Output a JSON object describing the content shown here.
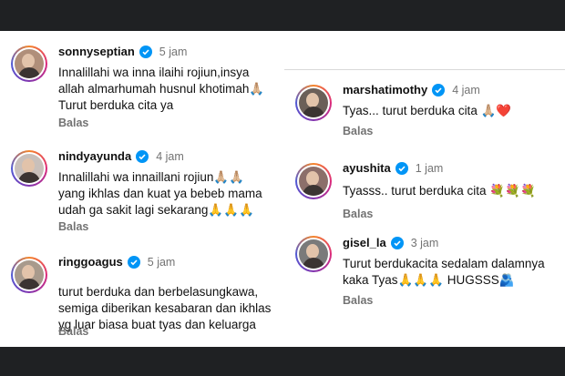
{
  "colors": {
    "verified": "#0095f6",
    "muted": "#737373",
    "background": "#1f2123"
  },
  "left_comments": [
    {
      "username": "sonnyseptian",
      "time": "5 jam",
      "lines": [
        "Innalillahi wa inna ilaihi rojiun,insya",
        "allah almarhumah husnul khotimah🙏🏼",
        "Turut berduka cita ya"
      ],
      "reply": "Balas"
    },
    {
      "username": "nindyayunda",
      "time": "4 jam",
      "lines": [
        "Innalillahi wa innaillani rojiun🙏🏼🙏🏼",
        "yang ikhlas dan kuat ya bebeb mama",
        "udah ga sakit lagi sekarang🙏🙏🙏"
      ],
      "reply": "Balas"
    },
    {
      "username": "ringgoagus",
      "time": "5 jam",
      "lines": [
        "turut berduka dan berbelasungkawa,",
        "semiga diberikan kesabaran dan ikhlas",
        "yg luar biasa buat tyas dan keluarga"
      ],
      "reply": "Balas"
    }
  ],
  "right_comments": [
    {
      "username": "marshatimothy",
      "time": "4 jam",
      "lines": [
        "Tyas... turut berduka cita 🙏🏼❤️"
      ],
      "reply": "Balas"
    },
    {
      "username": "ayushita",
      "time": "1 jam",
      "lines": [
        "Tyasss.. turut berduka cita 💐💐💐"
      ],
      "reply": "Balas"
    },
    {
      "username": "gisel_la",
      "time": "3 jam",
      "lines": [
        "Turut berdukacita sedalam dalamnya",
        "kaka Tyas🙏🙏🙏 HUGSSS🫂"
      ],
      "reply": "Balas"
    }
  ]
}
